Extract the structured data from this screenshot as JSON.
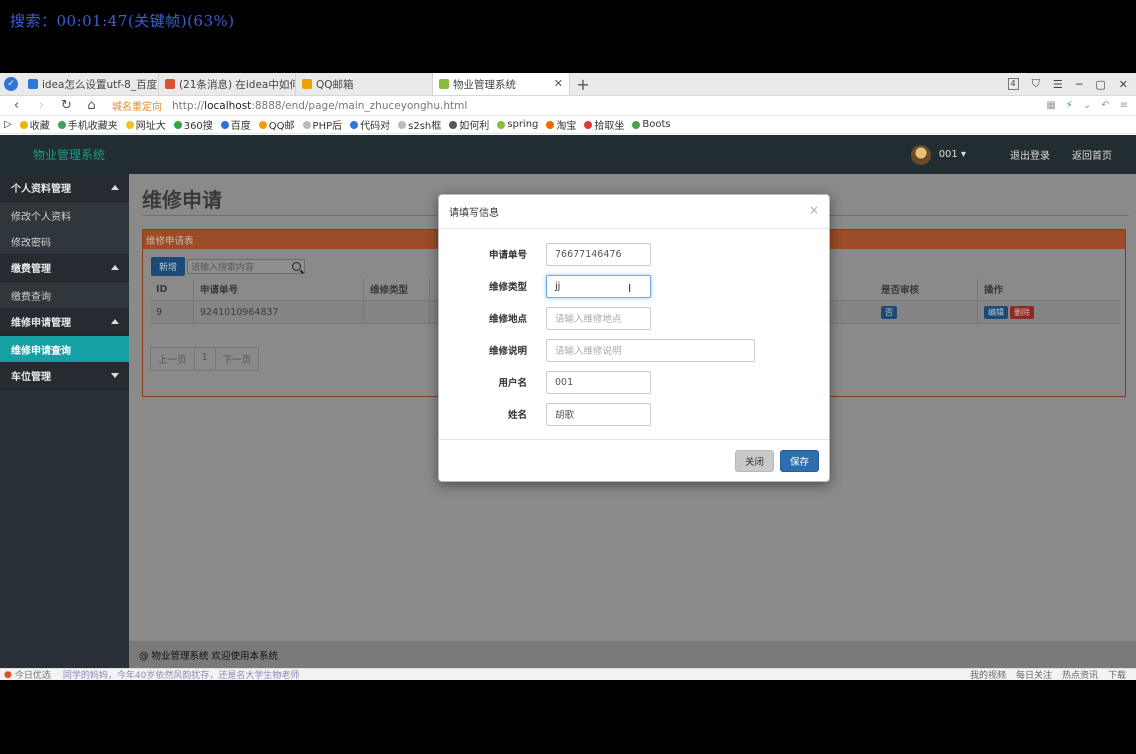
{
  "overlay": {
    "text": "搜索：00:01:47(关键帧)(63%)"
  },
  "browser": {
    "tabs": [
      {
        "label": "idea怎么设置utf-8_百度",
        "fav_color": "#2f76d8"
      },
      {
        "label": "(21条消息) 在idea中如何",
        "fav_color": "#d9532c"
      },
      {
        "label": "QQ邮箱",
        "fav_color": "#f0a000"
      },
      {
        "label": "物业管理系统",
        "fav_color": "#8bbb3a"
      }
    ],
    "tab_count_badge": "4",
    "address": {
      "redirect_label": "城名重定向",
      "url_prefix": "http://",
      "url_host": "localhost",
      "url_rest": ":8888/end/page/main_zhuceyonghu.html"
    },
    "bookmarks": [
      "收藏",
      "手机收藏夹",
      "网址大",
      "360搜",
      "百度",
      "QQ邮",
      "PHP后",
      "代码对",
      "s2sh框",
      "如何利",
      "spring",
      "淘宝",
      "拾取坐",
      "Boots"
    ]
  },
  "app": {
    "brand": "物业管理系统",
    "user": "001",
    "logout": "退出登录",
    "home": "返回首页",
    "sidebar": [
      {
        "type": "group",
        "label": "个人资料管理",
        "caret": "up"
      },
      {
        "type": "item",
        "label": "修改个人资料"
      },
      {
        "type": "item",
        "label": "修改密码"
      },
      {
        "type": "group",
        "label": "缴费管理",
        "caret": "up"
      },
      {
        "type": "item",
        "label": "缴费查询"
      },
      {
        "type": "group",
        "label": "维修申请管理",
        "caret": "up"
      },
      {
        "type": "item",
        "label": "维修申请查询",
        "active": true
      },
      {
        "type": "group",
        "label": "车位管理",
        "caret": "down"
      }
    ],
    "page_title": "维修申请",
    "panel_title": "维修申请表",
    "new_button": "新增",
    "search_placeholder": "请输入搜索内容",
    "table": {
      "headers": [
        "ID",
        "申请单号",
        "维修类型",
        "是否审核",
        "操作"
      ],
      "rows": [
        {
          "id": "9",
          "number": "9241010964837",
          "type": "",
          "approved": "否",
          "edit": "编辑",
          "delete": "删除"
        }
      ]
    },
    "pager": {
      "prev": "上一页",
      "page": "1",
      "next": "下一页"
    },
    "footer": "@ 物业管理系统 欢迎使用本系统"
  },
  "modal": {
    "title": "请填写信息",
    "close": "×",
    "fields": [
      {
        "label": "申请单号",
        "value": "76677146476",
        "placeholder": ""
      },
      {
        "label": "维修类型",
        "value": "jj",
        "placeholder": ""
      },
      {
        "label": "维修地点",
        "value": "",
        "placeholder": "请输入维修地点"
      },
      {
        "label": "维修说明",
        "value": "",
        "placeholder": "请输入维修说明"
      },
      {
        "label": "用户名",
        "value": "001",
        "placeholder": ""
      },
      {
        "label": "姓名",
        "value": "胡歌",
        "placeholder": ""
      }
    ],
    "close_button": "关闭",
    "save_button": "保存"
  },
  "statusbar": {
    "left": "今日优选",
    "news": "同学的妈妈，今年40岁依然风韵犹存，还是名大学生物老师",
    "right": [
      "我的视频",
      "每日关注",
      "热点资讯",
      "下载"
    ]
  }
}
